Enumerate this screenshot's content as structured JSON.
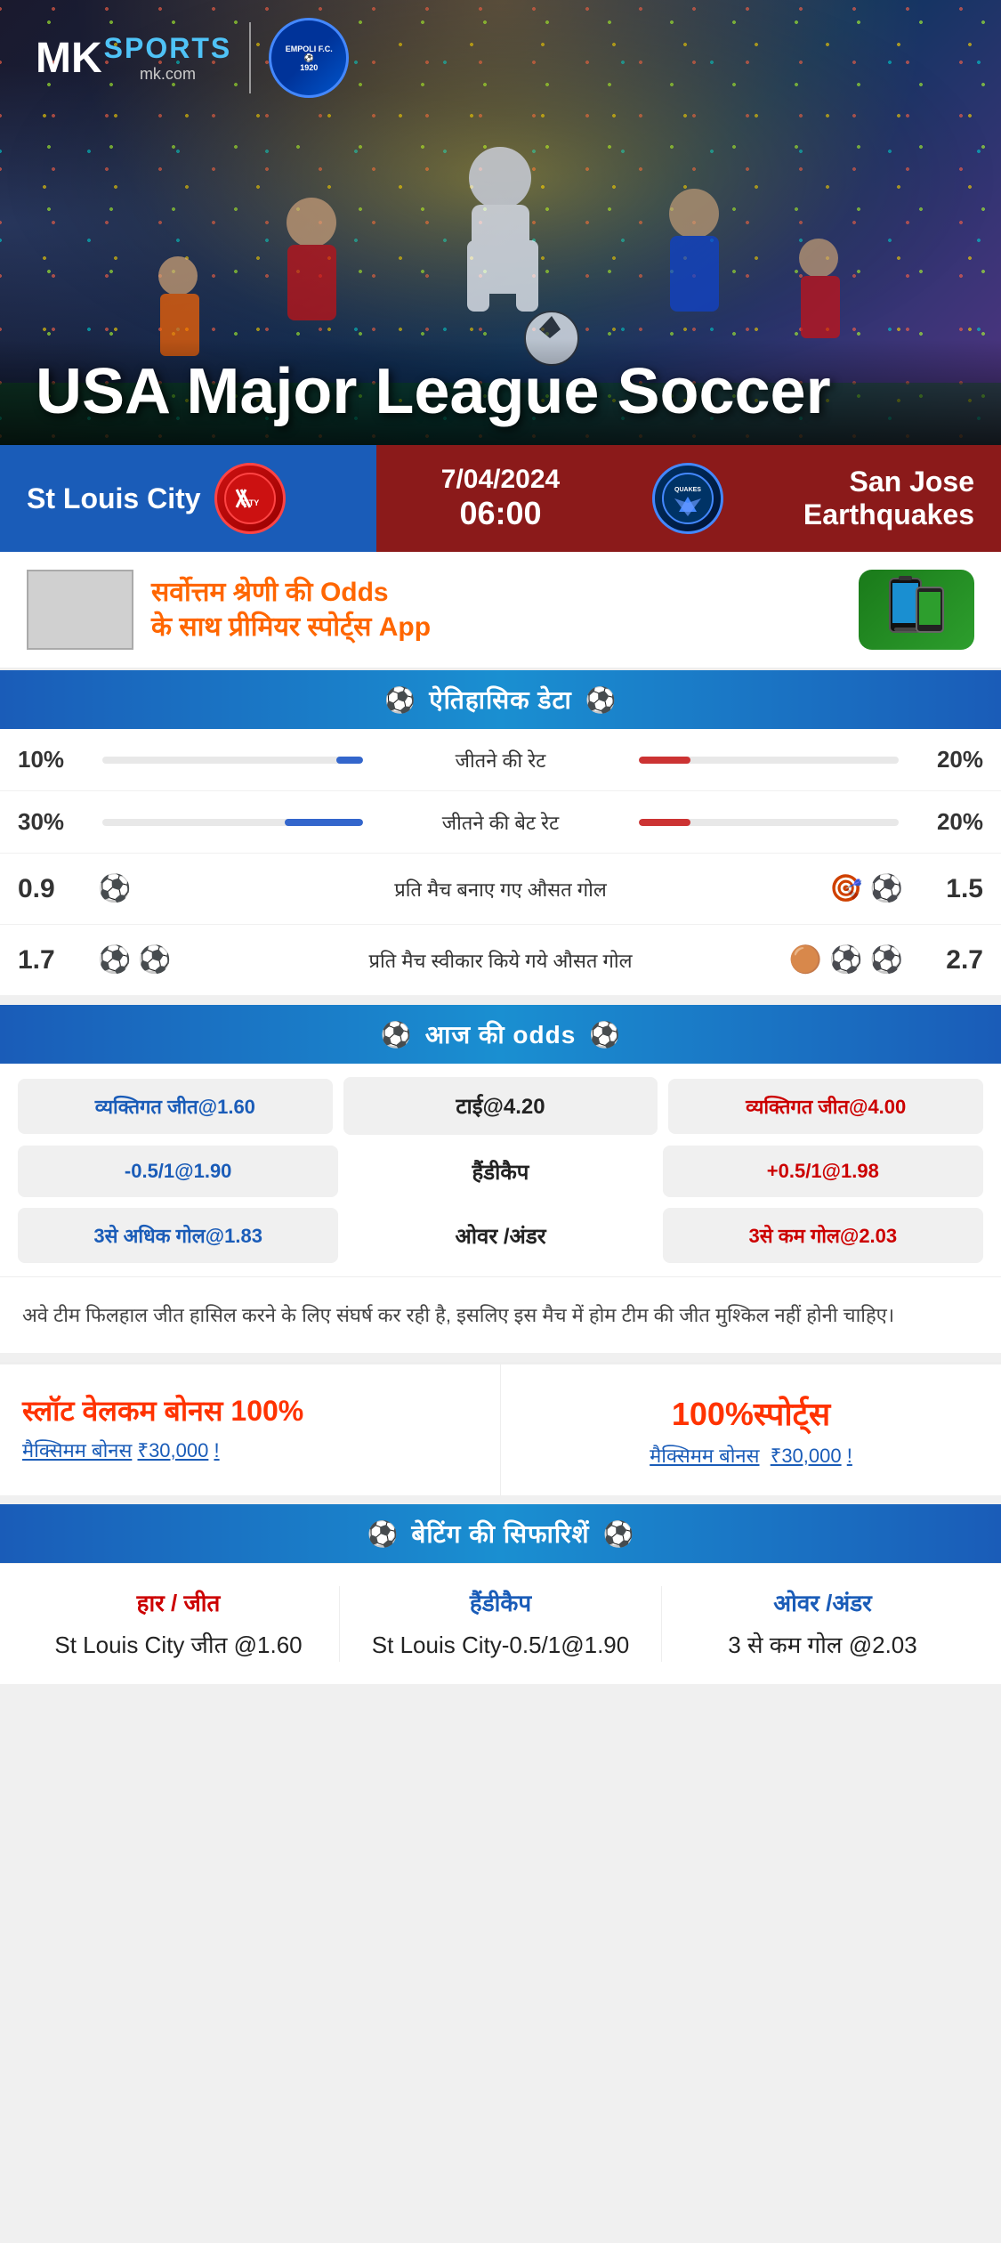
{
  "brand": {
    "name_mk": "MK",
    "name_sports": "SPORTS",
    "url": "mk.com",
    "partner": "EMPOLI F.C.",
    "partner_year": "1920"
  },
  "hero": {
    "title": "USA Major League Soccer"
  },
  "match": {
    "date": "7/04/2024",
    "time": "06:00",
    "home_team": "St Louis City",
    "away_team": "San Jose Earthquakes",
    "away_team_short": "QUAKES"
  },
  "promo": {
    "text_line1": "सर्वोत्तम श्रेणी की",
    "text_highlight": "Odds",
    "text_line2": "के साथ प्रीमियर स्पोर्ट्स",
    "text_app": "App"
  },
  "historical": {
    "section_title": "ऐतिहासिक डेटा",
    "stats": [
      {
        "label": "जीतने की रेट",
        "left_val": "10%",
        "right_val": "20%",
        "left_pct": 10,
        "right_pct": 20
      },
      {
        "label": "जीतने की बेट रेट",
        "left_val": "30%",
        "right_val": "20%",
        "left_pct": 30,
        "right_pct": 20
      }
    ],
    "goals": [
      {
        "label": "प्रति मैच बनाए गए औसत गोल",
        "left_val": "0.9",
        "right_val": "1.5",
        "left_balls": 1,
        "right_balls": 2
      },
      {
        "label": "प्रति मैच स्वीकार किये गये औसत गोल",
        "left_val": "1.7",
        "right_val": "2.7",
        "left_balls": 2,
        "right_balls": 3
      }
    ]
  },
  "odds": {
    "section_title": "आज की odds",
    "rows": [
      {
        "left": "व्यक्तिगत जीत@1.60",
        "center_label": "टाई@4.20",
        "right": "व्यक्तिगत जीत@4.00"
      },
      {
        "left": "-0.5/1@1.90",
        "center_label": "हैंडीकैप",
        "right": "+0.5/1@1.98"
      },
      {
        "left": "3से अधिक गोल@1.83",
        "center_label": "ओवर /अंडर",
        "right": "3से कम गोल@2.03"
      }
    ]
  },
  "description": "अवे टीम फिलहाल जीत हासिल करने के लिए संघर्ष कर रही है, इसलिए इस मैच में होम टीम की जीत मुश्किल नहीं होनी चाहिए।",
  "bonus": {
    "left_title": "स्लॉट वेलकम बोनस",
    "left_percent": "100%",
    "left_subtitle": "मैक्सिमम बोनस",
    "left_amount": "₹30,000",
    "left_exclaim": "!",
    "right_percent": "100%",
    "right_label": "स्पोर्ट्स",
    "right_subtitle": "मैक्सिमम बोनस",
    "right_amount": "₹30,000",
    "right_exclaim": "!"
  },
  "recommendations": {
    "section_title": "बेटिंग की सिफारिशें",
    "cols": [
      {
        "label": "हार / जीत",
        "label_color": "red",
        "value": "St Louis City जीत @1.60"
      },
      {
        "label": "हैंडीकैप",
        "label_color": "blue",
        "value": "St Louis City-0.5/1@1.90"
      },
      {
        "label": "ओवर /अंडर",
        "label_color": "blue",
        "value": "3 से कम गोल @2.03"
      }
    ]
  }
}
